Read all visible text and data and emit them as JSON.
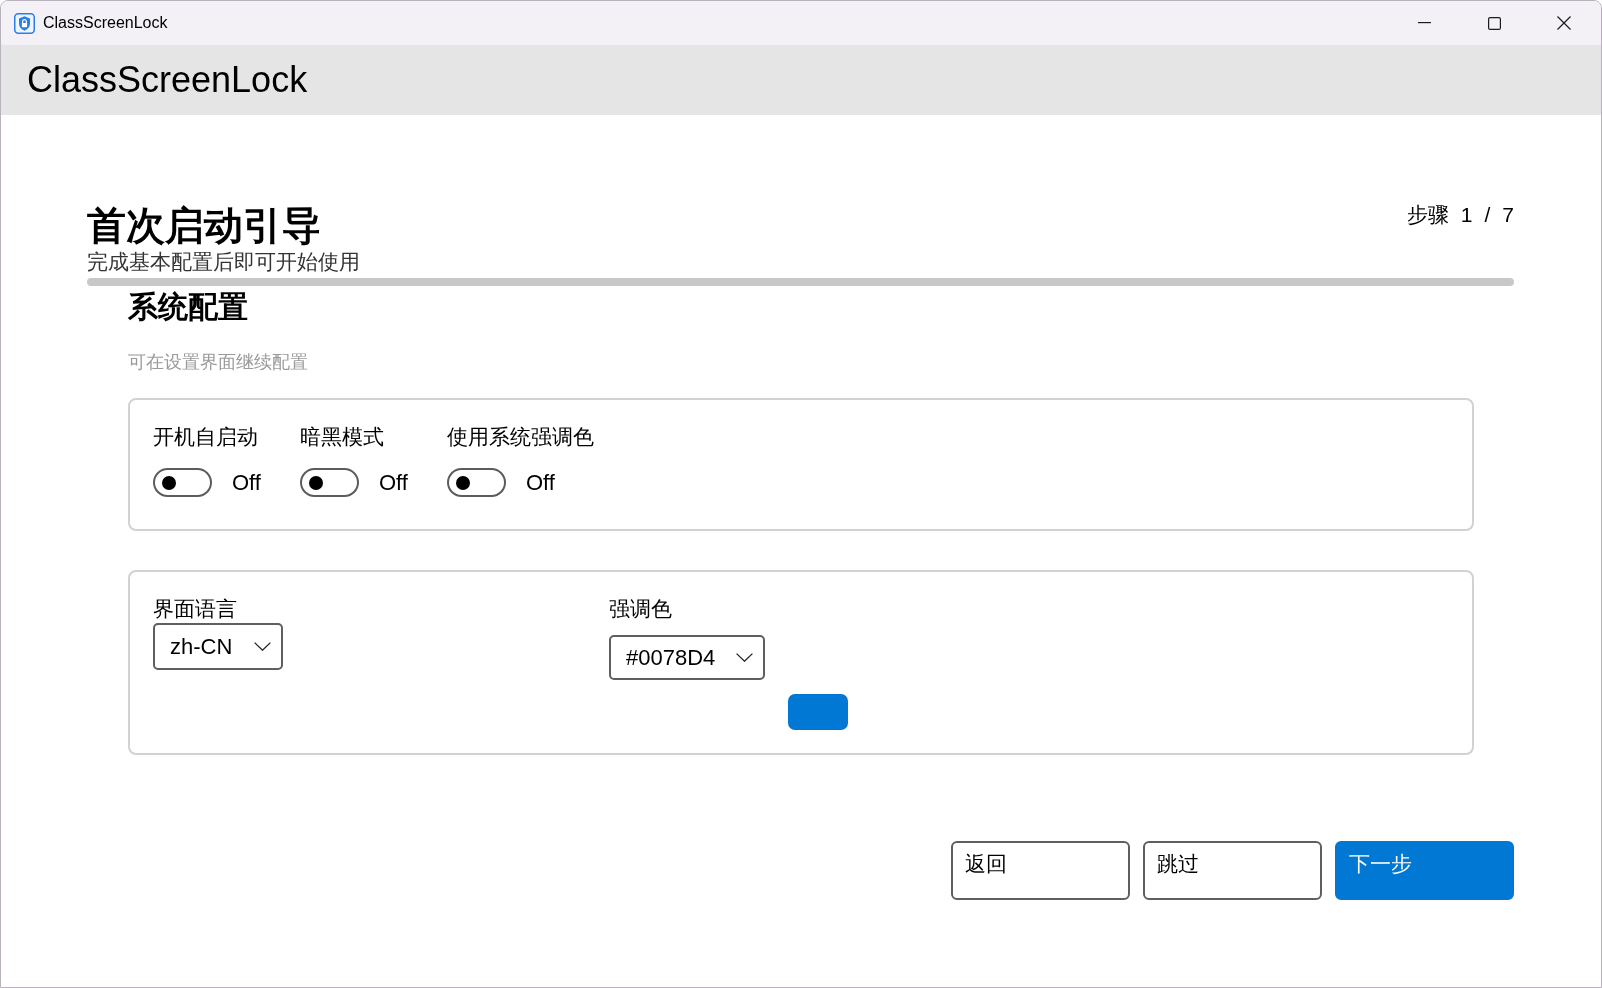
{
  "window": {
    "title": "ClassScreenLock"
  },
  "header": {
    "title": "ClassScreenLock"
  },
  "wizard": {
    "title": "首次启动引导",
    "subtitle": "完成基本配置后即可开始使用",
    "step": {
      "label": "步骤",
      "current": "1",
      "separator": "/",
      "total": "7"
    },
    "progress": {
      "level": 0
    }
  },
  "section": {
    "title": "系统配置",
    "hint": "可在设置界面继续配置"
  },
  "toggles": [
    {
      "label": "开机自启动",
      "on": false,
      "state_text": "Off"
    },
    {
      "label": "暗黑模式",
      "on": false,
      "state_text": "Off"
    },
    {
      "label": "使用系统强调色",
      "on": false,
      "state_text": "Off"
    }
  ],
  "language": {
    "label": "界面语言",
    "value": "zh-CN"
  },
  "accent": {
    "label": "强调色",
    "value": "#0078D4",
    "color": "#0078d4"
  },
  "buttons": [
    {
      "label": "返回",
      "kind": "secondary"
    },
    {
      "label": "跳过",
      "kind": "secondary"
    },
    {
      "label": "下一步",
      "kind": "primary"
    }
  ]
}
